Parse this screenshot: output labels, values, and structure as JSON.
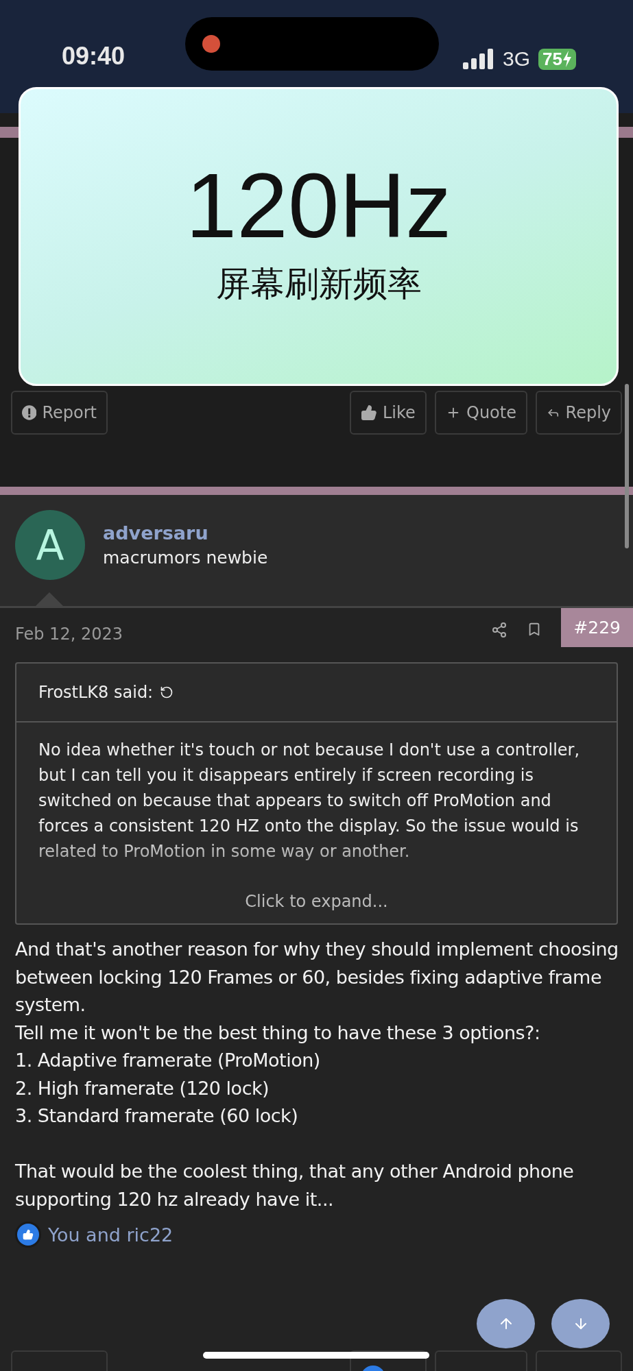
{
  "status_bar": {
    "time": "09:40",
    "network": "3G",
    "battery": "75"
  },
  "overlay": {
    "title": "120Hz",
    "subtitle": "屏幕刷新频率"
  },
  "top_actions": [
    {
      "kind": "report",
      "label": "Report"
    },
    {
      "kind": "like",
      "label": "Like"
    },
    {
      "kind": "quote",
      "label": "Quote"
    },
    {
      "kind": "reply",
      "label": "Reply"
    }
  ],
  "post": {
    "avatar_letter": "A",
    "author": "adversaru",
    "role": "macrumors newbie",
    "date": "Feb 12, 2023",
    "number": "#229",
    "quote": {
      "author": "FrostLK8 said:",
      "text": "No idea whether it's touch or not because I don't use a controller, but I can tell you it disappears entirely if screen recording is switched on because that appears to switch off ProMotion and forces a consistent 120 HZ onto the display. So the issue would is related to ProMotion in some way or another.",
      "expand": "Click to expand..."
    },
    "body": [
      [
        "And that's another reason for why they should implement choosing between locking 120 Frames or 60, besides fixing adaptive frame system.",
        "Tell me it won't be the best thing to have these 3 options?:",
        "1. Adaptive framerate (ProMotion)",
        "2. High framerate (120 lock)",
        "3. Standard framerate (60 lock)"
      ],
      [
        "That would be the coolest thing, that any other Android phone supporting 120 hz already have it..."
      ]
    ],
    "likes": "You and ric22"
  },
  "bottom_actions": [
    {
      "kind": "report",
      "liked": false
    },
    {
      "kind": "like",
      "liked": true
    },
    {
      "kind": "quote",
      "liked": false
    },
    {
      "kind": "reply",
      "liked": false
    }
  ]
}
